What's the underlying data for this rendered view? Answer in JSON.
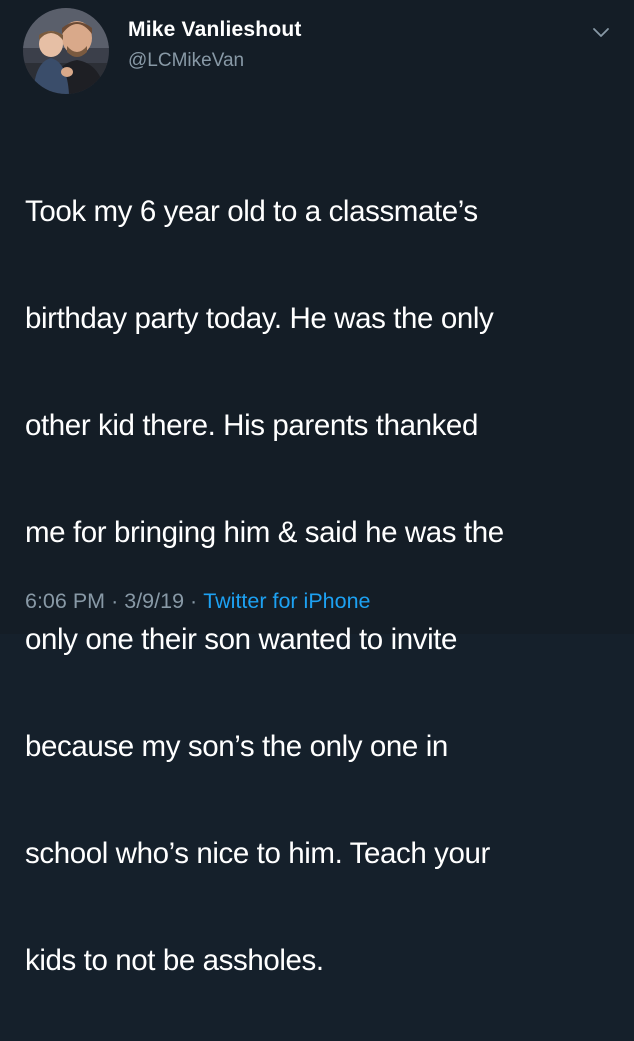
{
  "tweet": {
    "author": {
      "display_name": "Mike Vanlieshout",
      "handle": "@LCMikeVan",
      "avatar_icon": "profile-photo-avatar"
    },
    "menu_icon": "chevron-down-icon",
    "text_lines": [
      "Took my 6 year old to a classmate’s",
      "birthday party today. He was the only",
      "other kid there. His parents thanked",
      "me for bringing him & said he was the",
      "only one their son wanted to invite",
      "because my son’s the only one in",
      "school who’s nice to him. Teach your",
      "kids to not be assholes."
    ],
    "meta": {
      "time": "6:06 PM",
      "separator": "·",
      "date": "3/9/19",
      "source": "Twitter for iPhone"
    }
  },
  "colors": {
    "background": "#141d26",
    "primary_text": "#ffffff",
    "secondary_text": "#8899a6",
    "link": "#1da1f2"
  }
}
